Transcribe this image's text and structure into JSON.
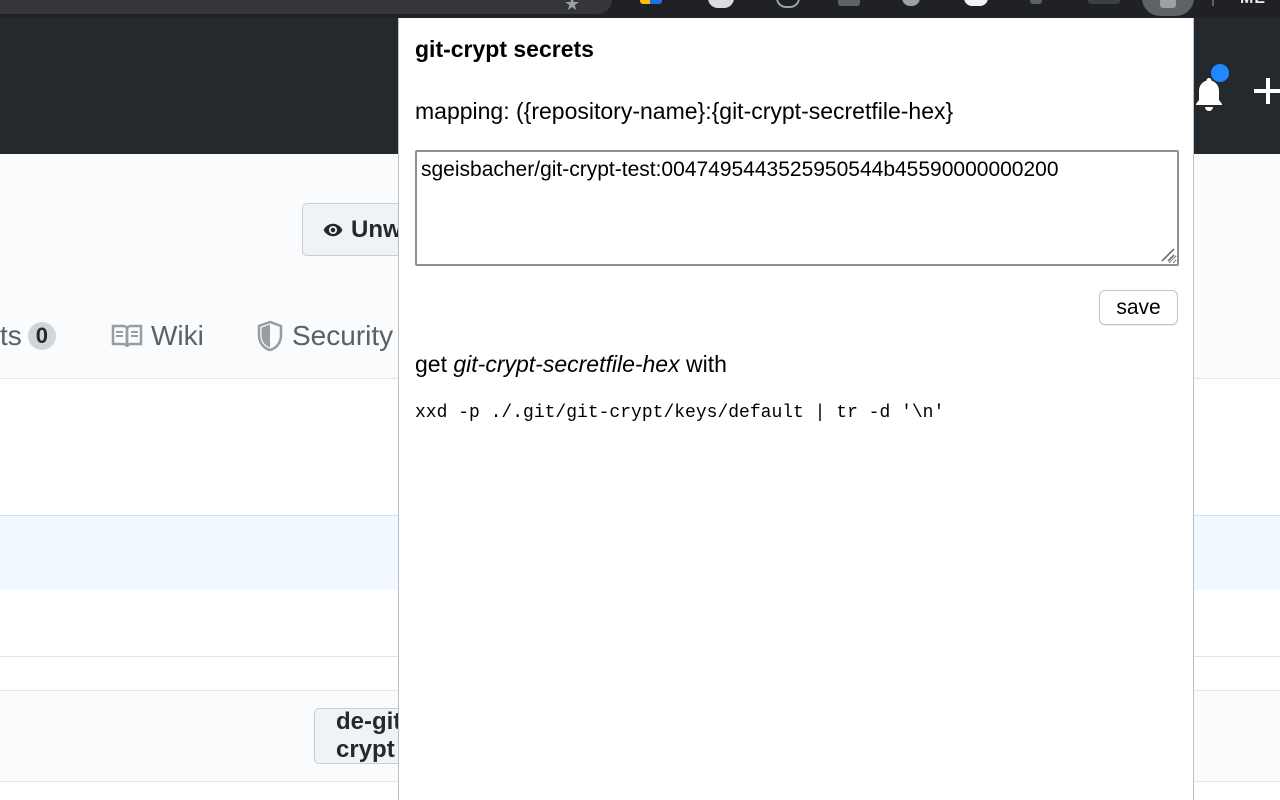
{
  "browser": {
    "profile_letters": "ME"
  },
  "repo": {
    "watch_label": "Unwatch",
    "tabs": [
      {
        "label": "Projects",
        "visible_text": "ts",
        "count": "0"
      },
      {
        "label": "Wiki"
      },
      {
        "label": "Security"
      }
    ],
    "branch_button_label": "de-git-crypt"
  },
  "popup": {
    "title": "git-crypt secrets",
    "mapping_text": "mapping: ({repository-name}:{git-crypt-secretfile-hex}",
    "secrets_value": "sgeisbacher/git-crypt-test:0047495443525950544b45590000000200",
    "save_label": "save",
    "hint_prefix": "get ",
    "hint_emphasis": "git-crypt-secretfile-hex",
    "hint_suffix": " with",
    "command": "xxd -p ./.git/git-crypt/keys/default | tr -d '\\n'"
  },
  "colors": {
    "header_bg": "#24292e",
    "notification_dot": "#2188ff",
    "selected_row_bg": "#f1f8ff"
  },
  "icons": [
    "star-icon",
    "bell-icon",
    "plus-icon",
    "eye-icon",
    "book-icon",
    "shield-icon",
    "resize-grip-icon"
  ]
}
